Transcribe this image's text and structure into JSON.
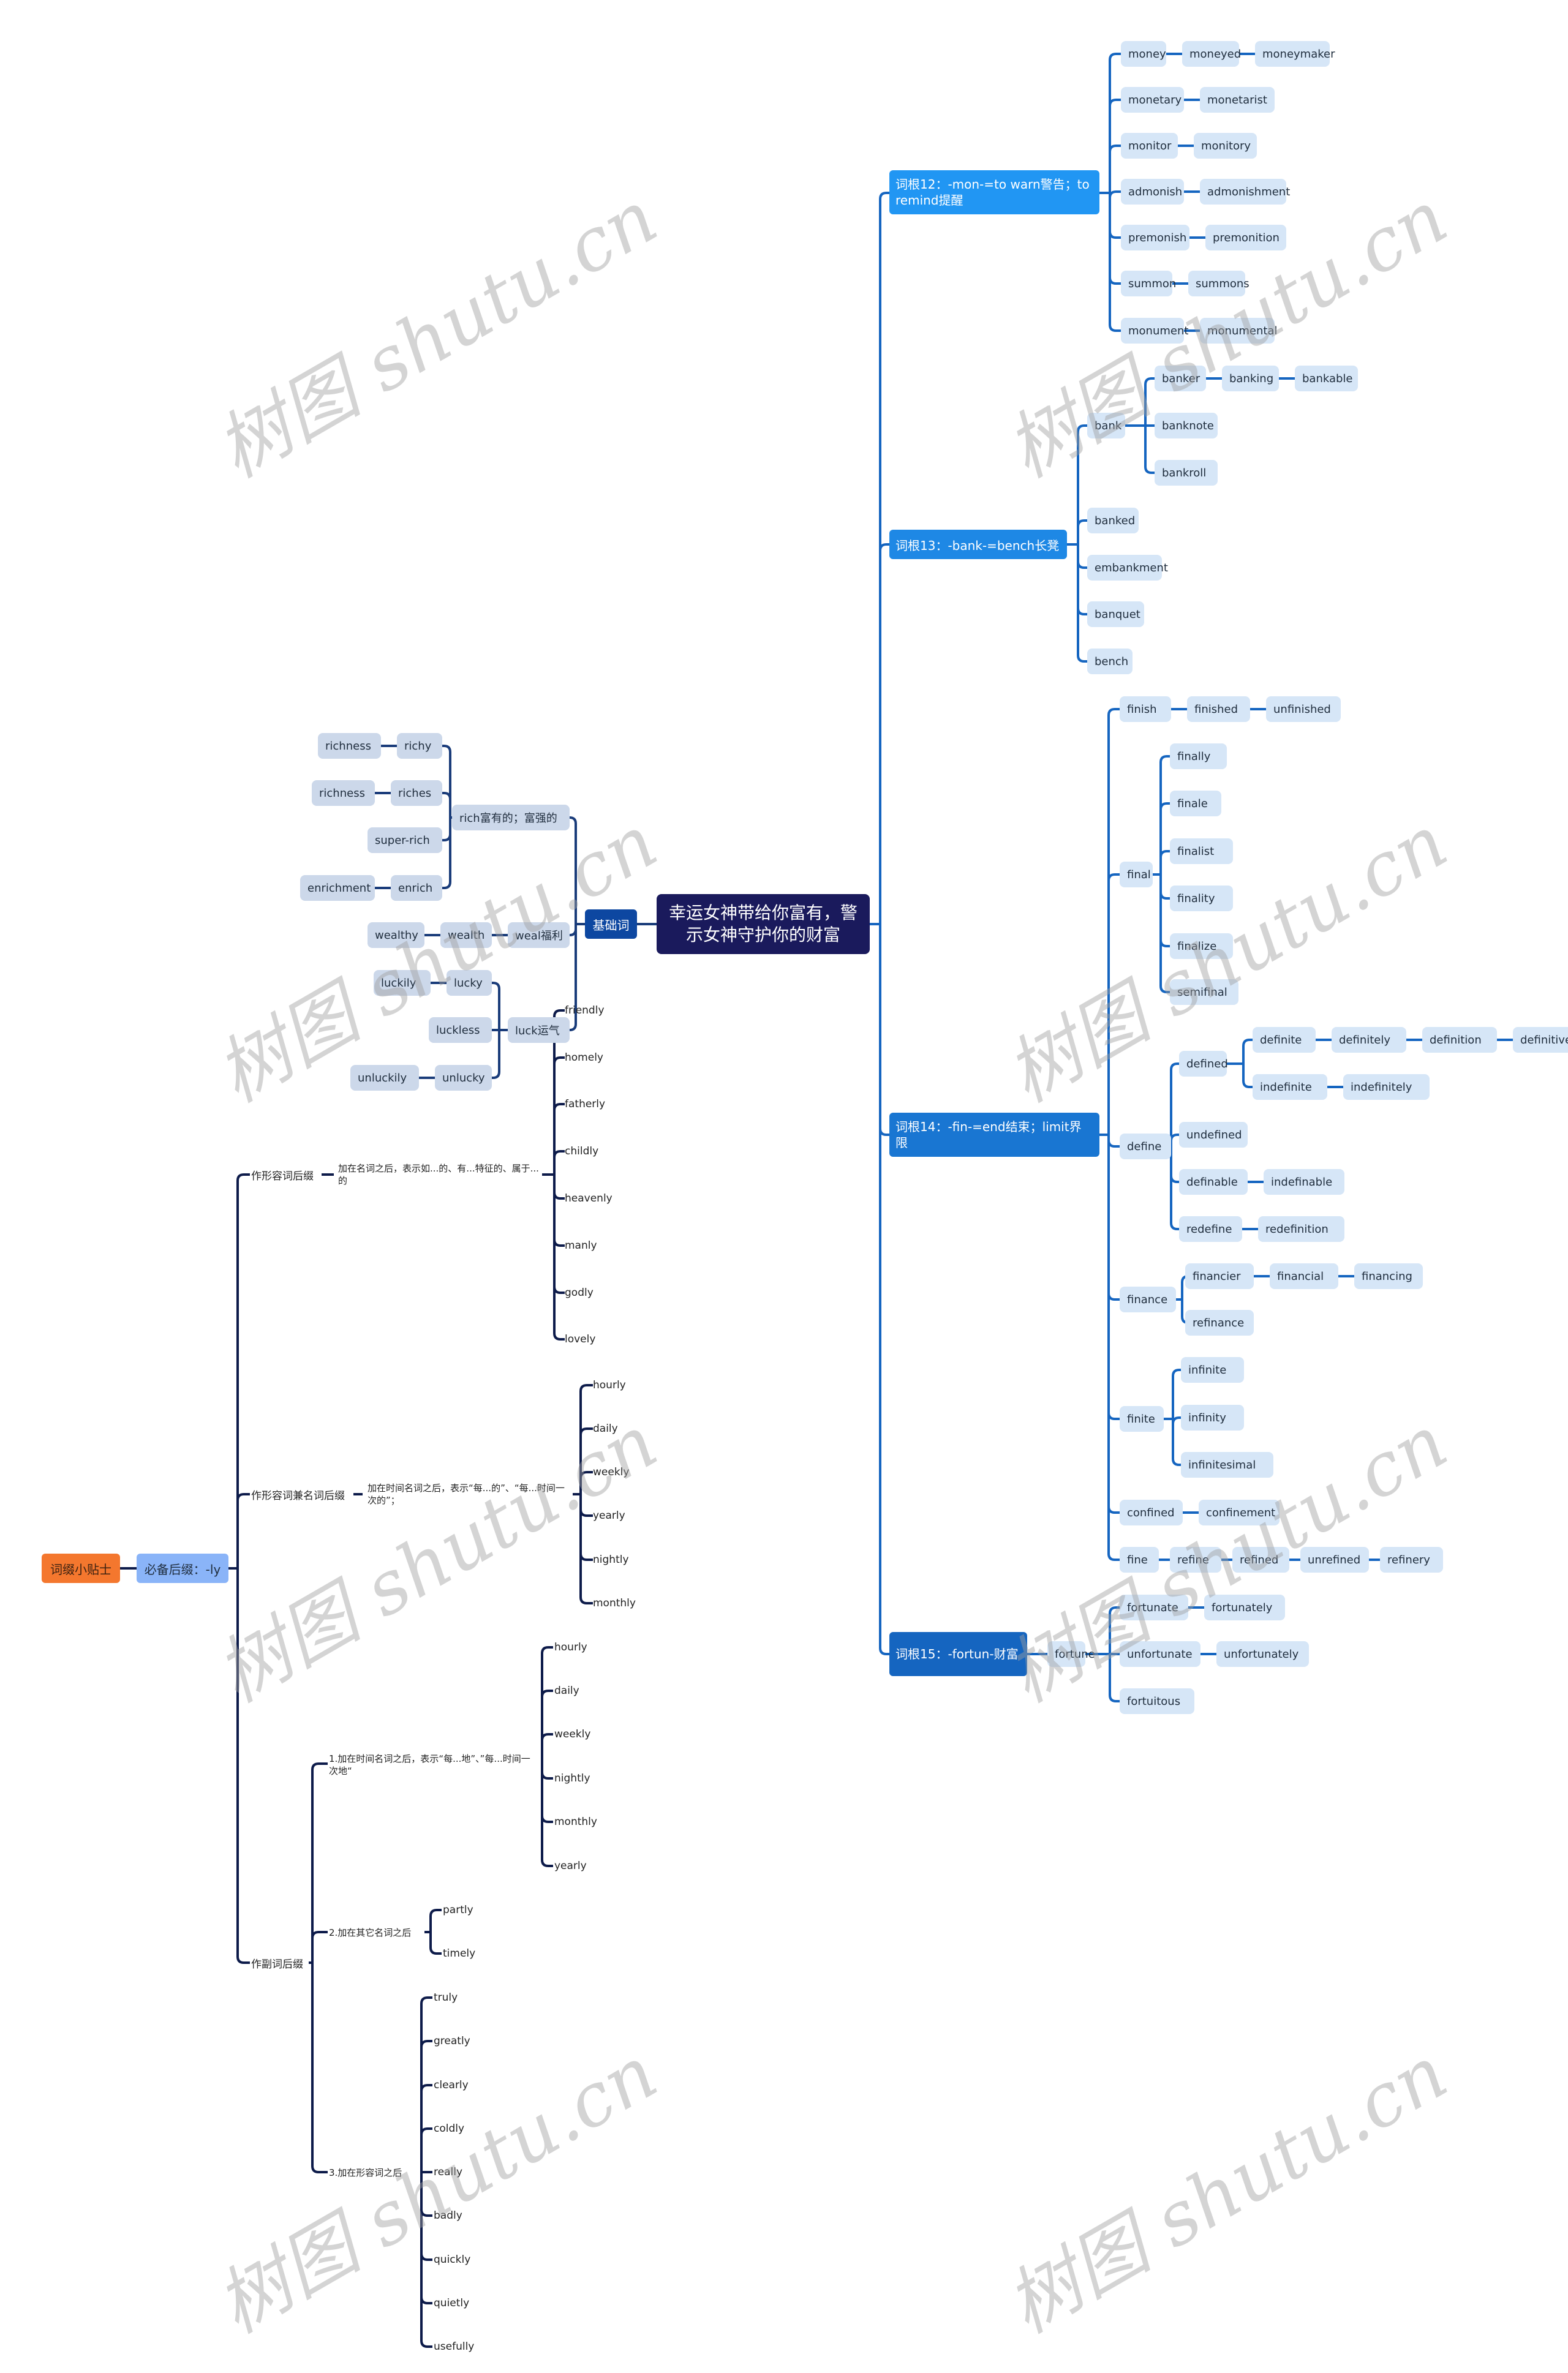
{
  "root": "幸运女神带给你富有，警示女神守护你的财富",
  "branches": {
    "b12": {
      "label": "词根12：-mon-=to  warn警告；to remind提醒",
      "rows": [
        [
          "money",
          "moneyed",
          "moneymaker"
        ],
        [
          "monetary",
          "monetarist"
        ],
        [
          "monitor",
          "monitory"
        ],
        [
          "admonish",
          "admonishment"
        ],
        [
          "premonish",
          "premonition"
        ],
        [
          "summon",
          "summons"
        ],
        [
          "monument",
          "monumental"
        ]
      ]
    },
    "b13": {
      "label": "词根13：-bank-=bench长凳",
      "bank": "bank",
      "bank_children": [
        [
          "banker",
          "banking",
          "bankable"
        ],
        [
          "banknote"
        ],
        [
          "bankroll"
        ]
      ],
      "others": [
        "banked",
        "embankment",
        "banquet",
        "bench"
      ]
    },
    "b14": {
      "label": "词根14：-fin-=end结束；limit界限",
      "finish": [
        "finish",
        "finished",
        "unfinished"
      ],
      "final": "final",
      "final_children": [
        "finally",
        "finale",
        "finalist",
        "finality",
        "finalize",
        "semifinal"
      ],
      "define": "define",
      "defined": "defined",
      "defined_children": [
        [
          "definite",
          "definitely",
          "definition",
          "definitive"
        ],
        [
          "indefinite",
          "indefinitely"
        ]
      ],
      "define_children": [
        [
          "undefined"
        ],
        [
          "definable",
          "indefinable"
        ],
        [
          "redefine",
          "redefinition"
        ]
      ],
      "finance": "finance",
      "finance_children": [
        [
          "financier",
          "financial",
          "financing"
        ],
        [
          "refinance"
        ]
      ],
      "finite": "finite",
      "finite_children": [
        "infinite",
        "infinity",
        "infinitesimal"
      ],
      "confined": [
        "confined",
        "confinement"
      ],
      "fine": [
        "fine",
        "refine",
        "refined",
        "unrefined",
        "refinery"
      ]
    },
    "b15": {
      "label": "词根15：-fortun-财富",
      "fortune": "fortune",
      "children": [
        [
          "fortunate",
          "fortunately"
        ],
        [
          "unfortunate",
          "unfortunately"
        ],
        [
          "fortuitous"
        ]
      ]
    },
    "basic": {
      "label": "基础词",
      "rich": "rich富有的；富强的",
      "rich_children": [
        [
          "richness",
          "richy"
        ],
        [
          "richness",
          "riches"
        ],
        [
          "super-rich"
        ],
        [
          "enrichment",
          "enrich"
        ]
      ],
      "weal": [
        "wealthy",
        "wealth",
        "weal福利"
      ],
      "luck": "luck运气",
      "luck_children": [
        [
          "luckily",
          "lucky"
        ],
        [
          "luckless"
        ],
        [
          "unluckily",
          "unlucky"
        ]
      ]
    }
  },
  "tip": {
    "label": "词缀小贴士",
    "suffix": "必备后缀：-ly",
    "adj": {
      "label": "作形容词后缀",
      "note": "加在名词之后，表示如...的、有...特征的、属于...的",
      "words": [
        "friendly",
        "homely",
        "fatherly",
        "childly",
        "heavenly",
        "manly",
        "godly",
        "lovely"
      ]
    },
    "adjnoun": {
      "label": "作形容词兼名词后缀",
      "note": "加在时间名词之后，表示“每...的”、“每...时间一次的”；",
      "words": [
        "hourly",
        "daily",
        "weekly",
        "yearly",
        "nightly",
        "monthly"
      ]
    },
    "adv": {
      "label": "作副词后缀",
      "groups": [
        {
          "note": "1.加在时间名词之后，表示“每...地”、”每...时间一次地“",
          "words": [
            "hourly",
            "daily",
            "weekly",
            "nightly",
            "monthly",
            "yearly"
          ]
        },
        {
          "note": "2.加在其它名词之后",
          "words": [
            "partly",
            "timely"
          ]
        },
        {
          "note": "3.加在形容词之后",
          "words": [
            "truly",
            "greatly",
            "clearly",
            "coldly",
            "really",
            "badly",
            "quickly",
            "quietly",
            "usefully"
          ]
        }
      ]
    }
  },
  "watermark": "树图 shutu.cn",
  "colors": {
    "root": "#1a1a5c",
    "line_right": "#1565c0",
    "line_left": "#0d1b4a",
    "leaf": "#d6e6f7",
    "tip": "#f4772e",
    "suffix": "#8ab4f8"
  }
}
